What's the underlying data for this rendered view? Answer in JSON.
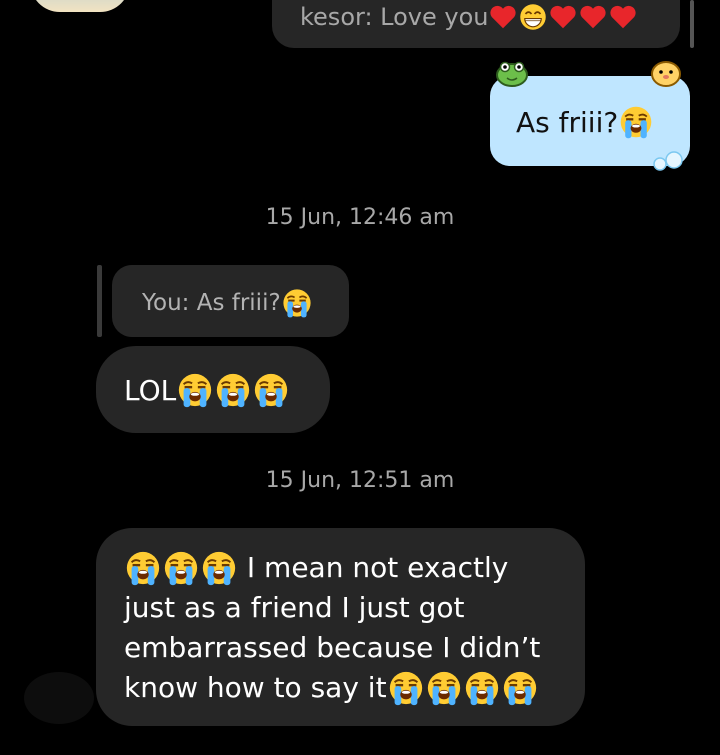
{
  "top_reply": {
    "text": "kesor: Love you"
  },
  "sent_message": {
    "text": "As friii?"
  },
  "timestamps": [
    "15 Jun, 12:46 am",
    "15 Jun, 12:51 am"
  ],
  "reply_preview": {
    "text": "You: As friii?"
  },
  "messages": [
    {
      "text": "LOL"
    },
    {
      "lines": [
        " I mean not exactly",
        "just as a friend I just got",
        "embarrassed because I didn’t",
        "know how to say it"
      ]
    }
  ],
  "colors": {
    "background": "#000000",
    "received_bubble": "#262626",
    "sent_bubble": "#bfe6ff",
    "timestamp": "#a8a8a8"
  },
  "icons": [
    "heart-icon",
    "grinning-face-icon",
    "loudly-crying-face-icon",
    "frog-sticker-icon",
    "hamster-sticker-icon",
    "bubbles-sticker-icon"
  ]
}
